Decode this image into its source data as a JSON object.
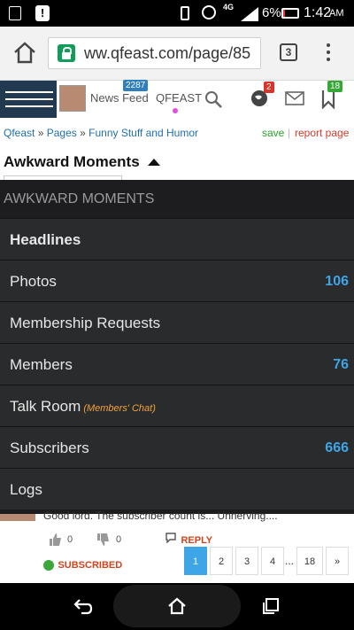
{
  "status_bar": {
    "battery": "6%",
    "time": "1:42",
    "ampm": "AM",
    "network": "4G"
  },
  "browser": {
    "url": "ww.qfeast.com/page/85",
    "tab_count": "3"
  },
  "site_header": {
    "news_feed_label": "News Feed",
    "news_feed_badge": "2287",
    "brand_label": "QFEAST",
    "notifications_badge": "2",
    "right_badge": "18"
  },
  "breadcrumb": {
    "items": [
      "Qfeast",
      "Pages",
      "Funny Stuff and Humor"
    ],
    "separator": "»",
    "save_label": "save",
    "report_label": "report page"
  },
  "page": {
    "title": "Awkward Moments"
  },
  "menu": {
    "header": "AWKWARD MOMENTS",
    "items": [
      {
        "label": "Headlines",
        "count": ""
      },
      {
        "label": "Photos",
        "count": "106"
      },
      {
        "label": "Membership Requests",
        "count": ""
      },
      {
        "label": "Members",
        "count": "76"
      },
      {
        "label": "Talk Room",
        "sub": "(Members' Chat)",
        "count": ""
      },
      {
        "label": "Subscribers",
        "count": "666"
      },
      {
        "label": "Logs",
        "count": ""
      }
    ]
  },
  "comment": {
    "text": "Good lord. The subscriber count is... Unnerving....",
    "like_count": "0",
    "dislike_count": "0",
    "reply_label": "REPLY",
    "subscribed_label": "SUBSCRIBED"
  },
  "pager": {
    "pages": [
      "1",
      "2",
      "3",
      "4"
    ],
    "ellipsis": "...",
    "last": "18",
    "next": "»"
  },
  "colors": {
    "accent_blue": "#3ea5e6",
    "menu_bg": "#2a2b2d",
    "header_navy": "#213a52",
    "save_green": "#2aa52a",
    "report_red": "#d23b2e",
    "subscribed_red": "#d2431b"
  }
}
